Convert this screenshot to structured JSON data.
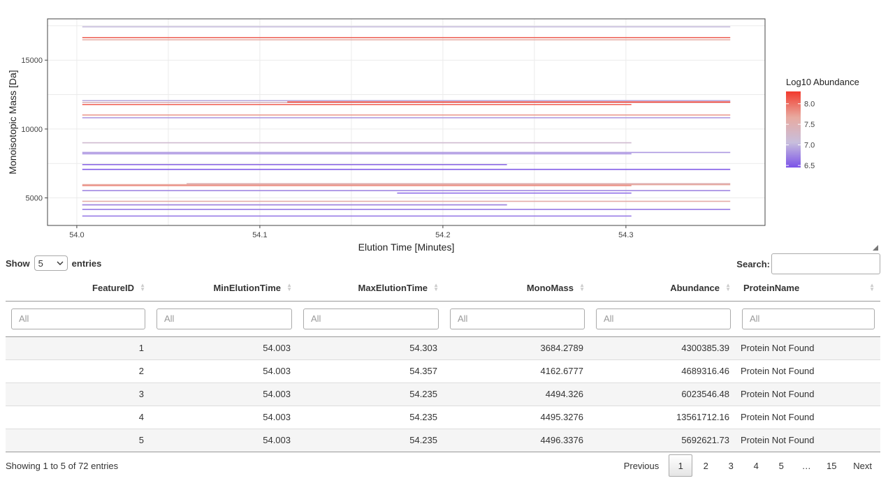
{
  "chart_data": {
    "type": "line",
    "xlabel": "Elution Time [Minutes]",
    "ylabel": "Monoisotopic Mass [Da]",
    "xlim": [
      53.984,
      54.376
    ],
    "ylim": [
      3000,
      18000
    ],
    "xticks": [
      54.0,
      54.1,
      54.2,
      54.3
    ],
    "xtick_labels": [
      "54.0",
      "54.1",
      "54.2",
      "54.3"
    ],
    "yticks": [
      5000,
      10000,
      15000
    ],
    "ytick_labels": [
      "5000",
      "10000",
      "15000"
    ],
    "grid": true,
    "legend": {
      "title": "Log10 Abundance",
      "position": "right",
      "min": 6.45,
      "max": 8.3,
      "ticks": [
        "6.5",
        "7.0",
        "7.5",
        "8.0"
      ],
      "tick_values": [
        6.5,
        7.0,
        7.5,
        8.0
      ],
      "colors": [
        "#7b52e8",
        "#c8bedc",
        "#e8aaa0",
        "#f23a2d"
      ]
    },
    "segments": [
      {
        "x0": 54.003,
        "x1": 54.303,
        "y": 3684.28,
        "c": 6.63
      },
      {
        "x0": 54.003,
        "x1": 54.357,
        "y": 4162.68,
        "c": 6.67
      },
      {
        "x0": 54.003,
        "x1": 54.235,
        "y": 4494.33,
        "c": 6.78
      },
      {
        "x0": 54.003,
        "x1": 54.235,
        "y": 4495.33,
        "c": 7.13
      },
      {
        "x0": 54.003,
        "x1": 54.235,
        "y": 4496.34,
        "c": 6.76
      },
      {
        "x0": 54.003,
        "x1": 54.357,
        "y": 4750,
        "c": 7.6
      },
      {
        "x0": 54.175,
        "x1": 54.303,
        "y": 5350,
        "c": 6.55
      },
      {
        "x0": 54.003,
        "x1": 54.357,
        "y": 5530,
        "c": 6.75
      },
      {
        "x0": 54.003,
        "x1": 54.303,
        "y": 5900,
        "c": 7.9
      },
      {
        "x0": 54.003,
        "x1": 54.357,
        "y": 5960,
        "c": 7.7
      },
      {
        "x0": 54.06,
        "x1": 54.357,
        "y": 6030,
        "c": 7.5
      },
      {
        "x0": 54.003,
        "x1": 54.357,
        "y": 7070,
        "c": 6.5
      },
      {
        "x0": 54.003,
        "x1": 54.235,
        "y": 7420,
        "c": 6.6
      },
      {
        "x0": 54.003,
        "x1": 54.303,
        "y": 8200,
        "c": 6.8
      },
      {
        "x0": 54.003,
        "x1": 54.357,
        "y": 8300,
        "c": 6.85
      },
      {
        "x0": 54.003,
        "x1": 54.303,
        "y": 9000,
        "c": 7.2
      },
      {
        "x0": 54.003,
        "x1": 54.357,
        "y": 10820,
        "c": 6.85
      },
      {
        "x0": 54.003,
        "x1": 54.357,
        "y": 11020,
        "c": 7.8
      },
      {
        "x0": 54.003,
        "x1": 54.303,
        "y": 11780,
        "c": 8.1
      },
      {
        "x0": 54.003,
        "x1": 54.357,
        "y": 11930,
        "c": 7.4
      },
      {
        "x0": 54.115,
        "x1": 54.357,
        "y": 11960,
        "c": 8.25
      },
      {
        "x0": 54.003,
        "x1": 54.357,
        "y": 12060,
        "c": 6.95
      },
      {
        "x0": 54.003,
        "x1": 54.357,
        "y": 16480,
        "c": 7.65
      },
      {
        "x0": 54.003,
        "x1": 54.357,
        "y": 16640,
        "c": 8.05
      },
      {
        "x0": 54.003,
        "x1": 54.357,
        "y": 17420,
        "c": 7.05
      }
    ]
  },
  "controls": {
    "show_label": "Show",
    "entries_label": "entries",
    "page_size": "5",
    "search_label": "Search:",
    "search_value": ""
  },
  "table": {
    "columns": [
      "FeatureID",
      "MinElutionTime",
      "MaxElutionTime",
      "MonoMass",
      "Abundance",
      "ProteinName"
    ],
    "filter_placeholder": "All",
    "rows": [
      [
        "1",
        "54.003",
        "54.303",
        "3684.2789",
        "4300385.39",
        "Protein Not Found"
      ],
      [
        "2",
        "54.003",
        "54.357",
        "4162.6777",
        "4689316.46",
        "Protein Not Found"
      ],
      [
        "3",
        "54.003",
        "54.235",
        "4494.326",
        "6023546.48",
        "Protein Not Found"
      ],
      [
        "4",
        "54.003",
        "54.235",
        "4495.3276",
        "13561712.16",
        "Protein Not Found"
      ],
      [
        "5",
        "54.003",
        "54.235",
        "4496.3376",
        "5692621.73",
        "Protein Not Found"
      ]
    ]
  },
  "info": "Showing 1 to 5 of 72 entries",
  "pagination": {
    "previous": "Previous",
    "pages": [
      "1",
      "2",
      "3",
      "4",
      "5",
      "…",
      "15"
    ],
    "current": "1",
    "next": "Next"
  }
}
